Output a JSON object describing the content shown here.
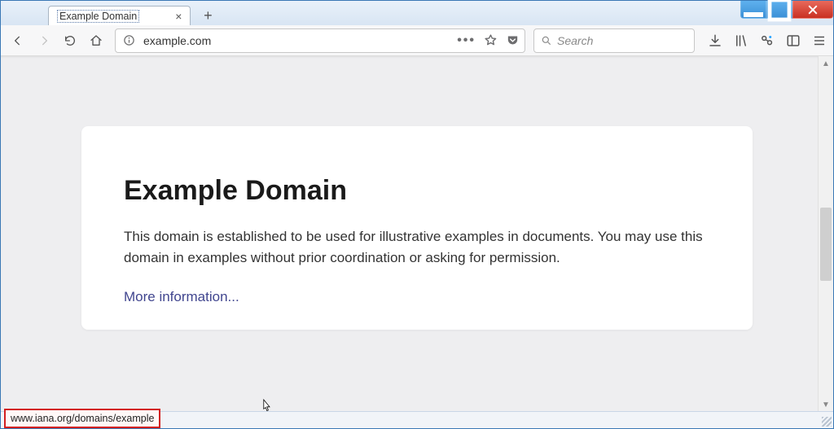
{
  "tab": {
    "title": "Example Domain"
  },
  "address": {
    "value": "example.com"
  },
  "search": {
    "placeholder": "Search"
  },
  "page": {
    "heading": "Example Domain",
    "paragraph": "This domain is established to be used for illustrative examples in documents. You may use this domain in examples without prior coordination or asking for permission.",
    "link_text": "More information..."
  },
  "status": {
    "hover_url": "www.iana.org/domains/example"
  }
}
